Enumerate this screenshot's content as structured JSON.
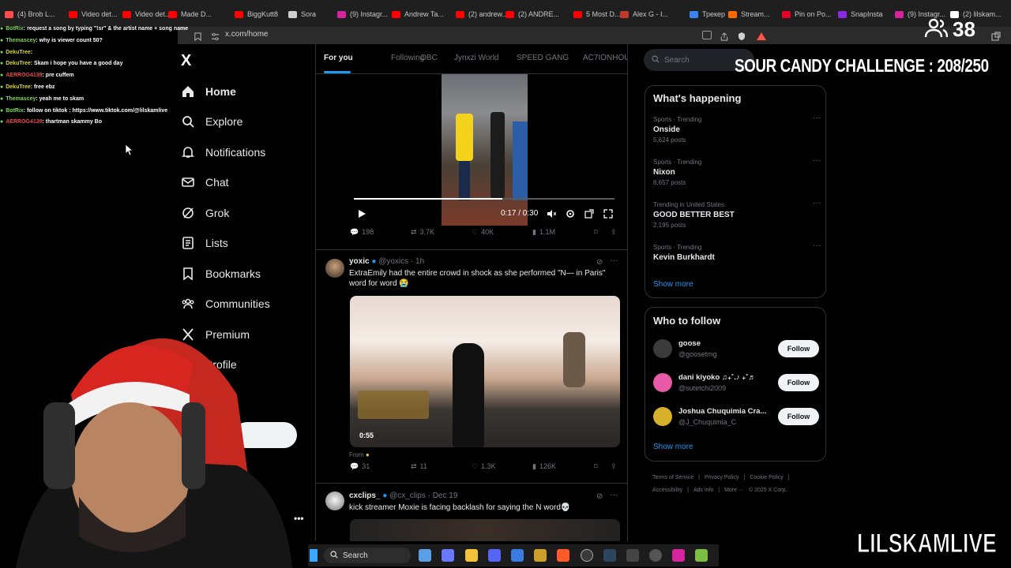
{
  "browser": {
    "tabs": [
      {
        "label": "(4) Brob L...",
        "color": "#ff4d4d"
      },
      {
        "label": "Video det...",
        "color": "#ff0000"
      },
      {
        "label": "Video det...",
        "color": "#ff0000"
      },
      {
        "label": "Made D...",
        "color": "#ff0000"
      },
      {
        "label": "BiggKutt8",
        "color": "#ff0000"
      },
      {
        "label": "Sora",
        "color": "#cfcfcf"
      },
      {
        "label": "(9) Instagr...",
        "color": "#d6249f"
      },
      {
        "label": "Andrew Ta...",
        "color": "#ff0000"
      },
      {
        "label": "(2) andrew...",
        "color": "#ff0000"
      },
      {
        "label": "(2) ANDRE...",
        "color": "#ff0000"
      },
      {
        "label": "5 Most D...",
        "color": "#ff0000"
      },
      {
        "label": "Alex G - I...",
        "color": "#c0392b"
      },
      {
        "label": "Трекер",
        "color": "#3b82f6"
      },
      {
        "label": "Stream...",
        "color": "#ff6a00"
      },
      {
        "label": "Pin on Po...",
        "color": "#e60023"
      },
      {
        "label": "SnapInsta",
        "color": "#8a2be2"
      },
      {
        "label": "(9) Instagr...",
        "color": "#d6249f"
      },
      {
        "label": "(2) lilskam...",
        "color": "#ffffff"
      }
    ],
    "address": "x.com/home"
  },
  "chat": [
    {
      "user": "BotRix",
      "user_color": "#7fd65a",
      "msg": ": request a song by typing \"!sr\" & the artist name + song name"
    },
    {
      "user": "Themascey",
      "user_color": "#7fd65a",
      "msg": ": why is viewer count 50?"
    },
    {
      "user": "DekuTree",
      "user_color": "#d6d640",
      "msg": ": "
    },
    {
      "user": "DekuTree",
      "user_color": "#d6d640",
      "msg": ": Skam i hope you have a good day"
    },
    {
      "user": "AERROG4139",
      "user_color": "#e84a4a",
      "msg": ": pre cuffem"
    },
    {
      "user": "DekuTree",
      "user_color": "#d6d640",
      "msg": ": free ebz"
    },
    {
      "user": "Themascey",
      "user_color": "#7fd65a",
      "msg": ": yeah me to skam"
    },
    {
      "user": "BotRix",
      "user_color": "#7fd65a",
      "msg": ": follow on tiktok : https://www.tiktok.com/@lilskamlive"
    },
    {
      "user": "AERROG4139",
      "user_color": "#e84a4a",
      "msg": ": thartman skammy Bo"
    }
  ],
  "nav": {
    "logo": "X",
    "items": [
      {
        "label": "Home",
        "icon": "home-icon"
      },
      {
        "label": "Explore",
        "icon": "search-icon"
      },
      {
        "label": "Notifications",
        "icon": "bell-icon"
      },
      {
        "label": "Chat",
        "icon": "mail-icon"
      },
      {
        "label": "Grok",
        "icon": "grok-icon"
      },
      {
        "label": "Lists",
        "icon": "list-icon"
      },
      {
        "label": "Bookmarks",
        "icon": "bookmark-icon"
      },
      {
        "label": "Communities",
        "icon": "people-icon"
      },
      {
        "label": "Premium",
        "icon": "x-icon"
      },
      {
        "label": "Profile",
        "icon": "user-icon"
      },
      {
        "label": "ore",
        "icon": "more-icon"
      }
    ]
  },
  "feed": {
    "tabs": [
      "For you",
      "Following",
      "OBC",
      "Jynxzi World",
      "SPEED GANG",
      "AC7IONHOU"
    ],
    "tweet1": {
      "time": "0:17 / 0:30",
      "progress": 0.57,
      "stats": {
        "replies": "198",
        "reposts": "3.7K",
        "likes": "40K",
        "views": "1.1M"
      }
    },
    "tweet2": {
      "name": "yoxic",
      "handle": "@yoxics",
      "time": "· 1h",
      "text": "ExtraEmily had the entire crowd in shock as she performed \"N— in Paris\" word for word 😭",
      "duration": "0:55",
      "from": "From",
      "stats": {
        "replies": "31",
        "reposts": "11",
        "likes": "1.3K",
        "views": "126K"
      }
    },
    "tweet3": {
      "name": "cxclips_",
      "handle": "@cx_clips",
      "time": "· Dec 19",
      "text": "kick streamer Moxie is facing backlash for saying the N word💀"
    }
  },
  "right": {
    "search_placeholder": "Search",
    "happening_title": "What's happening",
    "trends": [
      {
        "meta": "Sports · Trending",
        "name": "Onside",
        "count": "5,624 posts"
      },
      {
        "meta": "Sports · Trending",
        "name": "Nixon",
        "count": "8,657 posts"
      },
      {
        "meta": "Trending in United States",
        "name": "GOOD BETTER BEST",
        "count": "2,195 posts"
      },
      {
        "meta": "Sports · Trending",
        "name": "Kevin Burkhardt",
        "count": ""
      }
    ],
    "show_more": "Show more",
    "follow_title": "Who to follow",
    "who_to_follow": [
      {
        "name": "goose",
        "handle": "@goosetmg",
        "button": "Follow"
      },
      {
        "name": "dani kiyoko ♫₊˚.♪ ₊˚♬",
        "handle": "@sutetchi2009",
        "button": "Follow"
      },
      {
        "name": "Joshua Chuquimia Cra...",
        "handle": "@J_Chuquimia_C",
        "button": "Follow"
      }
    ],
    "show_more_2": "Show more",
    "footer": [
      "Terms of Service",
      "|",
      "Privacy Policy",
      "|",
      "Cookie Policy",
      "|",
      "Accessibility",
      "|",
      "Ads info",
      "|",
      "More ···",
      "© 2025 X Corp."
    ]
  },
  "overlay": {
    "challenge": "SOUR CANDY CHALLENGE : 208/250",
    "viewers": "38",
    "brand": "LILSKAMLIVE"
  },
  "taskbar": {
    "search": "Search"
  }
}
